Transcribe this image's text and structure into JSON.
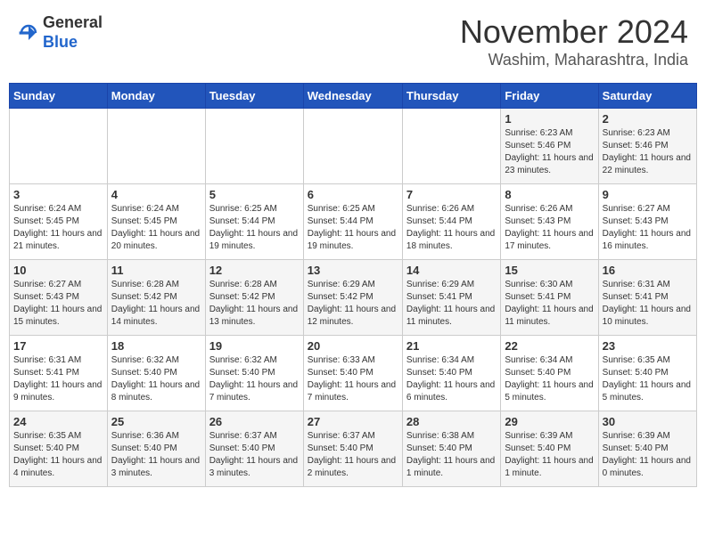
{
  "logo": {
    "general": "General",
    "blue": "Blue"
  },
  "header": {
    "month": "November 2024",
    "location": "Washim, Maharashtra, India"
  },
  "weekdays": [
    "Sunday",
    "Monday",
    "Tuesday",
    "Wednesday",
    "Thursday",
    "Friday",
    "Saturday"
  ],
  "weeks": [
    [
      {
        "day": "",
        "info": ""
      },
      {
        "day": "",
        "info": ""
      },
      {
        "day": "",
        "info": ""
      },
      {
        "day": "",
        "info": ""
      },
      {
        "day": "",
        "info": ""
      },
      {
        "day": "1",
        "info": "Sunrise: 6:23 AM\nSunset: 5:46 PM\nDaylight: 11 hours and 23 minutes."
      },
      {
        "day": "2",
        "info": "Sunrise: 6:23 AM\nSunset: 5:46 PM\nDaylight: 11 hours and 22 minutes."
      }
    ],
    [
      {
        "day": "3",
        "info": "Sunrise: 6:24 AM\nSunset: 5:45 PM\nDaylight: 11 hours and 21 minutes."
      },
      {
        "day": "4",
        "info": "Sunrise: 6:24 AM\nSunset: 5:45 PM\nDaylight: 11 hours and 20 minutes."
      },
      {
        "day": "5",
        "info": "Sunrise: 6:25 AM\nSunset: 5:44 PM\nDaylight: 11 hours and 19 minutes."
      },
      {
        "day": "6",
        "info": "Sunrise: 6:25 AM\nSunset: 5:44 PM\nDaylight: 11 hours and 19 minutes."
      },
      {
        "day": "7",
        "info": "Sunrise: 6:26 AM\nSunset: 5:44 PM\nDaylight: 11 hours and 18 minutes."
      },
      {
        "day": "8",
        "info": "Sunrise: 6:26 AM\nSunset: 5:43 PM\nDaylight: 11 hours and 17 minutes."
      },
      {
        "day": "9",
        "info": "Sunrise: 6:27 AM\nSunset: 5:43 PM\nDaylight: 11 hours and 16 minutes."
      }
    ],
    [
      {
        "day": "10",
        "info": "Sunrise: 6:27 AM\nSunset: 5:43 PM\nDaylight: 11 hours and 15 minutes."
      },
      {
        "day": "11",
        "info": "Sunrise: 6:28 AM\nSunset: 5:42 PM\nDaylight: 11 hours and 14 minutes."
      },
      {
        "day": "12",
        "info": "Sunrise: 6:28 AM\nSunset: 5:42 PM\nDaylight: 11 hours and 13 minutes."
      },
      {
        "day": "13",
        "info": "Sunrise: 6:29 AM\nSunset: 5:42 PM\nDaylight: 11 hours and 12 minutes."
      },
      {
        "day": "14",
        "info": "Sunrise: 6:29 AM\nSunset: 5:41 PM\nDaylight: 11 hours and 11 minutes."
      },
      {
        "day": "15",
        "info": "Sunrise: 6:30 AM\nSunset: 5:41 PM\nDaylight: 11 hours and 11 minutes."
      },
      {
        "day": "16",
        "info": "Sunrise: 6:31 AM\nSunset: 5:41 PM\nDaylight: 11 hours and 10 minutes."
      }
    ],
    [
      {
        "day": "17",
        "info": "Sunrise: 6:31 AM\nSunset: 5:41 PM\nDaylight: 11 hours and 9 minutes."
      },
      {
        "day": "18",
        "info": "Sunrise: 6:32 AM\nSunset: 5:40 PM\nDaylight: 11 hours and 8 minutes."
      },
      {
        "day": "19",
        "info": "Sunrise: 6:32 AM\nSunset: 5:40 PM\nDaylight: 11 hours and 7 minutes."
      },
      {
        "day": "20",
        "info": "Sunrise: 6:33 AM\nSunset: 5:40 PM\nDaylight: 11 hours and 7 minutes."
      },
      {
        "day": "21",
        "info": "Sunrise: 6:34 AM\nSunset: 5:40 PM\nDaylight: 11 hours and 6 minutes."
      },
      {
        "day": "22",
        "info": "Sunrise: 6:34 AM\nSunset: 5:40 PM\nDaylight: 11 hours and 5 minutes."
      },
      {
        "day": "23",
        "info": "Sunrise: 6:35 AM\nSunset: 5:40 PM\nDaylight: 11 hours and 5 minutes."
      }
    ],
    [
      {
        "day": "24",
        "info": "Sunrise: 6:35 AM\nSunset: 5:40 PM\nDaylight: 11 hours and 4 minutes."
      },
      {
        "day": "25",
        "info": "Sunrise: 6:36 AM\nSunset: 5:40 PM\nDaylight: 11 hours and 3 minutes."
      },
      {
        "day": "26",
        "info": "Sunrise: 6:37 AM\nSunset: 5:40 PM\nDaylight: 11 hours and 3 minutes."
      },
      {
        "day": "27",
        "info": "Sunrise: 6:37 AM\nSunset: 5:40 PM\nDaylight: 11 hours and 2 minutes."
      },
      {
        "day": "28",
        "info": "Sunrise: 6:38 AM\nSunset: 5:40 PM\nDaylight: 11 hours and 1 minute."
      },
      {
        "day": "29",
        "info": "Sunrise: 6:39 AM\nSunset: 5:40 PM\nDaylight: 11 hours and 1 minute."
      },
      {
        "day": "30",
        "info": "Sunrise: 6:39 AM\nSunset: 5:40 PM\nDaylight: 11 hours and 0 minutes."
      }
    ]
  ]
}
